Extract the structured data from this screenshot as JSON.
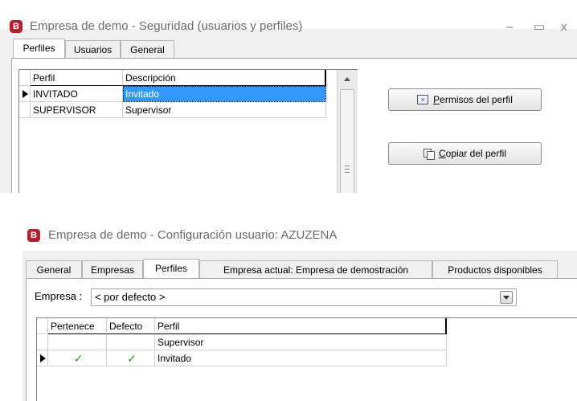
{
  "window1": {
    "app_icon": "B",
    "title": "Empresa de demo - Seguridad (usuarios y perfiles)",
    "controls": {
      "minimize": "–",
      "maximize": "▭",
      "close": "x"
    },
    "tabs": [
      {
        "label": "Perfiles",
        "active": true
      },
      {
        "label": "Usuarios",
        "active": false
      },
      {
        "label": "General",
        "active": false
      }
    ],
    "grid": {
      "columns": [
        "Perfil",
        "Descripción"
      ],
      "rows": [
        {
          "perfil": "INVITADO",
          "descripcion": "Invitado",
          "selected": true
        },
        {
          "perfil": "SUPERVISOR",
          "descripcion": "Supervisor",
          "selected": false
        }
      ]
    },
    "buttons": {
      "permisos": {
        "icon": "checkbox-x-icon",
        "mnemonic": "P",
        "rest": "ermisos del perfil"
      },
      "copiar": {
        "icon": "copy-icon",
        "mnemonic": "C",
        "rest": "opiar del perfil"
      }
    }
  },
  "window2": {
    "app_icon": "B",
    "title": "Empresa de demo - Configuración usuario: AZUZENA",
    "tabs": [
      {
        "label": "General",
        "active": false
      },
      {
        "label": "Empresas",
        "active": false
      },
      {
        "label": "Perfiles",
        "active": true
      },
      {
        "label": "Empresa actual: Empresa de demostración",
        "active": false
      },
      {
        "label": "Productos disponibles",
        "active": false
      }
    ],
    "empresa_label": "Empresa :",
    "empresa_value": "< por defecto >",
    "grid": {
      "columns": [
        "Pertenece",
        "Defecto",
        "Perfil"
      ],
      "rows": [
        {
          "pertenece": "",
          "defecto": "",
          "perfil": "Supervisor",
          "current": false
        },
        {
          "pertenece": "✓",
          "defecto": "✓",
          "perfil": "Invitado",
          "current": true
        }
      ]
    }
  },
  "colors": {
    "selection": "#3399ff",
    "app_icon": "#b5202e",
    "check": "#2e9a2e"
  }
}
